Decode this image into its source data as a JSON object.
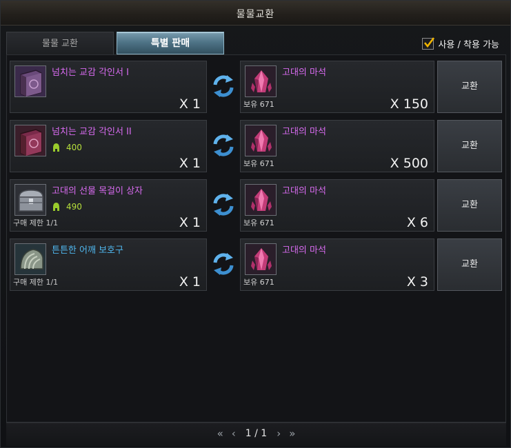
{
  "window": {
    "title": "물물교환"
  },
  "tabs": [
    {
      "label": "물물 교환",
      "active": false
    },
    {
      "label": "특별 판매",
      "active": true
    }
  ],
  "filter": {
    "label": "사용 / 착용 가능",
    "checked": true
  },
  "rows": [
    {
      "give": {
        "name": "넘치는 교감 각인서 I",
        "icon": "purple-book-icon",
        "price": "",
        "limit": "",
        "qty": "X 1"
      },
      "get": {
        "name": "고대의 마석",
        "icon": "crystal-icon",
        "owned": "보유 671",
        "qty": "X 150"
      },
      "button": "교환"
    },
    {
      "give": {
        "name": "넘치는 교감 각인서 II",
        "icon": "crimson-book-icon",
        "price": "400",
        "limit": "",
        "qty": "X 1"
      },
      "get": {
        "name": "고대의 마석",
        "icon": "crystal-icon",
        "owned": "보유 671",
        "qty": "X 500"
      },
      "button": "교환"
    },
    {
      "give": {
        "name": "고대의 선물 목걸이 상자",
        "icon": "silver-chest-icon",
        "price": "490",
        "limit": "구매 제한 1/1",
        "qty": "X 1"
      },
      "get": {
        "name": "고대의 마석",
        "icon": "crystal-icon",
        "owned": "보유 671",
        "qty": "X 6"
      },
      "button": "교환"
    },
    {
      "give": {
        "name": "튼튼한 어깨 보호구",
        "icon": "shoulder-guard-icon",
        "price": "",
        "limit": "구매 제한 1/1",
        "qty": "X 1"
      },
      "get": {
        "name": "고대의 마석",
        "icon": "crystal-icon",
        "owned": "보유 671",
        "qty": "X 3"
      },
      "button": "교환"
    }
  ],
  "pagination": {
    "text": "1 / 1"
  },
  "colors": {
    "purple_name": "#d86bf0",
    "blue_name": "#4fb7ee",
    "price": "#b7e03c",
    "tab_active": "#4f7487"
  }
}
